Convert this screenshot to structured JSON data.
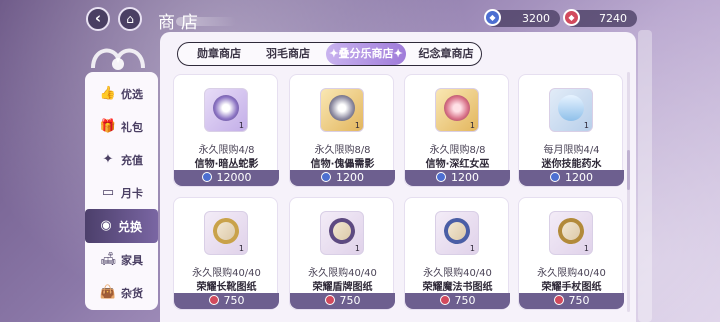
{
  "header": {
    "back_icon": "chevron-left-icon",
    "home_icon": "home-icon",
    "title": "商店"
  },
  "currencies": [
    {
      "icon": "blue-gem-icon",
      "value": "3200",
      "color": "#4d6fd1"
    },
    {
      "icon": "red-gem-icon",
      "value": "7240",
      "color": "#d24a5d"
    }
  ],
  "tabs": [
    {
      "label": "勋章商店"
    },
    {
      "label": "羽毛商店"
    },
    {
      "label": "✦叠分乐商店✦",
      "active": true
    },
    {
      "label": "纪念章商店"
    }
  ],
  "sidebar": {
    "items": [
      {
        "label": "优选",
        "icon": "thumbs-up-icon"
      },
      {
        "label": "礼包",
        "icon": "gift-icon"
      },
      {
        "label": "充值",
        "icon": "sparkle-bag-icon"
      },
      {
        "label": "月卡",
        "icon": "card-icon"
      },
      {
        "label": "兑换",
        "icon": "exchange-icon",
        "active": true
      },
      {
        "label": "家具",
        "icon": "sofa-icon"
      },
      {
        "label": "杂货",
        "icon": "bag-icon"
      }
    ]
  },
  "items": [
    {
      "limit": "永久限购4/8",
      "name": "信物·暗丛蛇影",
      "price": "12000",
      "currency": "blue",
      "qty": "1"
    },
    {
      "limit": "永久限购8/8",
      "name": "信物·傀儡需影",
      "price": "1200",
      "currency": "blue",
      "qty": "1"
    },
    {
      "limit": "永久限购8/8",
      "name": "信物·深红女巫",
      "price": "1200",
      "currency": "blue",
      "qty": "1"
    },
    {
      "limit": "每月限购4/4",
      "name": "迷你技能药水",
      "price": "1200",
      "currency": "blue",
      "qty": "1"
    },
    {
      "limit": "永久限购40/40",
      "name": "荣耀长靴图纸",
      "price": "750",
      "currency": "red",
      "qty": "1"
    },
    {
      "limit": "永久限购40/40",
      "name": "荣耀盾牌图纸",
      "price": "750",
      "currency": "red",
      "qty": "1"
    },
    {
      "limit": "永久限购40/40",
      "name": "荣耀魔法书图纸",
      "price": "750",
      "currency": "red",
      "qty": "1"
    },
    {
      "limit": "永久限购40/40",
      "name": "荣耀手杖图纸",
      "price": "750",
      "currency": "red",
      "qty": "1"
    }
  ],
  "colors": {
    "accent": "#6d5f8f",
    "active_tab": "#9f7bd9",
    "panel": "#f6f2fa"
  }
}
